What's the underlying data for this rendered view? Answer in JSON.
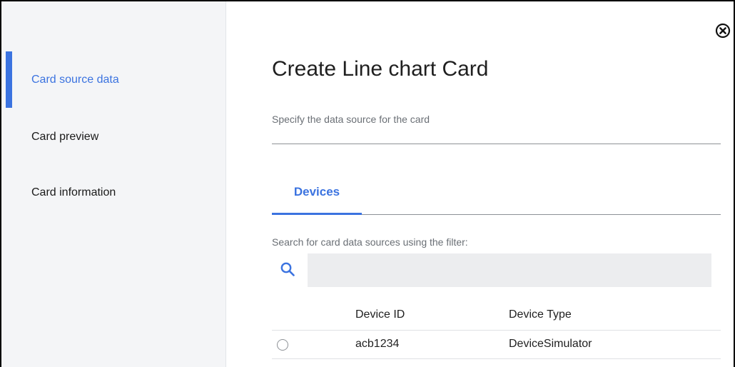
{
  "sidebar": {
    "items": [
      {
        "label": "Card source data",
        "active": true
      },
      {
        "label": "Card preview",
        "active": false
      },
      {
        "label": "Card information",
        "active": false
      }
    ]
  },
  "dialog": {
    "title": "Create Line chart Card",
    "subtitle": "Specify the data source for the card",
    "close_icon": "close-circle-icon"
  },
  "tabs": [
    {
      "label": "Devices",
      "selected": true
    }
  ],
  "filter": {
    "label": "Search for card data sources using the filter:",
    "search_icon": "search-icon",
    "value": "",
    "placeholder": ""
  },
  "table": {
    "columns": [
      "Device ID",
      "Device Type"
    ],
    "rows": [
      {
        "selected": false,
        "device_id": "acb1234",
        "device_type": "DeviceSimulator"
      }
    ]
  },
  "colors": {
    "accent": "#3b73e0",
    "sidebar_bg": "#f4f5f7",
    "input_bg": "#ecedef",
    "muted_text": "#6a6f75"
  }
}
